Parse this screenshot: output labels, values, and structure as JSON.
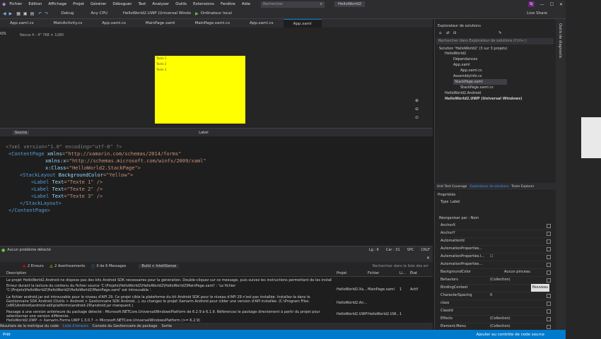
{
  "menu": [
    "Fichier",
    "Edition",
    "Affichage",
    "Projet",
    "Générer",
    "Déboguer",
    "Test",
    "Analyser",
    "Outils",
    "Extensions",
    "Fenêtre",
    "Aide"
  ],
  "search_placeholder": "Rechercher",
  "window_title": "HelloWorld2",
  "user_initials": "SJ",
  "toolbar": {
    "config": "Debug",
    "platform": "Any CPU",
    "startup": "HelloWorld2.UWP (Universal Windo",
    "run": "Ordinateur local",
    "live_share": "Live Share"
  },
  "doc_tabs": [
    "App.xaml.cs",
    "MainActivity.cs",
    "App.xaml.cs",
    "MainPage.xaml",
    "MainPage.xaml.cs",
    "App.xaml.cs",
    "App.xaml"
  ],
  "designer": {
    "label": "Nexus 4 - 4\" 768 × 1280",
    "labels": [
      "Texte 1",
      "Texte 2",
      "Texte 3"
    ],
    "preview_color": "#ffff00"
  },
  "split": {
    "source_label": "Source",
    "label_dropdown": "Label"
  },
  "code": {
    "l1": "<?xml version=\"1.0\" encoding=\"utf-8\" ?>",
    "l2a": "<ContentPage ",
    "l2b": "xmlns",
    "l2c": "=\"http://xamarin.com/schemas/2014/forms\"",
    "l3b": "xmlns:x",
    "l3c": "=\"http://schemas.microsoft.com/winfx/2009/xaml\"",
    "l4b": "x:Class",
    "l4c": "=\"HelloWorld2.StackPage\">",
    "l5a": "<StackLayout ",
    "l5b": "BackgroundColor",
    "l5c": "=\"Yellow\">",
    "l6a": "<Label ",
    "l6b": "Text",
    "l6c": "=\"Texte 1\" />",
    "l7a": "<Label ",
    "l7b": "Text",
    "l7c": "=\"Texte 2\" />",
    "l8a": "<Label ",
    "l8b": "Text",
    "l8c": "=\"Texte 3\" />",
    "l9": "</StackLayout>",
    "l10": "</ContentPage>"
  },
  "editor_status": {
    "issues": "Aucun problème détecté",
    "line": "Lg : 6",
    "col": "Car : 31",
    "spc": "SPC",
    "crlf": "CRLF"
  },
  "error_list": {
    "errors": "2 Erreurs",
    "warnings": "2 Avertissements",
    "messages": "0 de 6 Messages",
    "build": "Build + IntelliSense",
    "search": "Rechercher dans la liste des err",
    "col_desc": "Description",
    "col_project": "Projet",
    "col_file": "Fichier",
    "col_line": "Li...",
    "col_state": "État",
    "rows": [
      {
        "desc": "Le projet HelloWorld2.Android ne dispose pas des kits Android SDK nécessaires pour la génération. Double-cliquez sur ce message, puis suivez les instructions permettant de les installer.",
        "project": "",
        "file": "",
        "line": "",
        "state": ""
      },
      {
        "desc": "Erreur durant la lecture du contenu du fichier source 'C:\\Projets\\HelloWorld2\\HelloWorld2\\HelloWorld2\\MainPage.xaml' : 'Le fichier 'C:\\Projets\\HelloWorld2\\HelloWorld2\\HelloWorld2\\MainPage.xaml' est introuvable.'.",
        "project": "HelloWorld2-Xa...",
        "file": "MainPage.xaml",
        "line": "1",
        "state": "Actif"
      },
      {
        "desc": "La fichier android.jar est introuvable pour le niveau d'API 29. Ce projet cible la plateforme du kit Android SDK pour le niveau d'API 29 n'est pas installée. Installez-la dans le Gestionnaire SDK Android (Outils > Android > Gestionnaire SDK Android...), ou changez le projet Xamarin.Android pour cibler une version d'API installée. (C:\\Program Files (x86)\\Android\\android-sdk\\platforms\\android-29\\android.jar manquant.)",
        "project": "HelloWorld2.An...",
        "file": "",
        "line": "",
        "state": ""
      },
      {
        "desc": "Passage à une version antérieure du package détecté : Microsoft.NETCore.UniversalWindowsPlatform de 6.2.9 à 6.1.9. Référencez le package directement à partir du projet pour sélectionner une version différente.",
        "project": "HelloWorld2.UWP",
        "file": "HelloWorld2.UW...",
        "line": "1",
        "state": ""
      },
      {
        "desc": "HelloWorld2.UWP -> Xamarin.Forms.UWP 1.3.0.7 -> Microsoft.NETCore.UniversalWindowsPlatform (>= 6.2.9)",
        "project": "",
        "file": "",
        "line": "",
        "state": ""
      }
    ]
  },
  "bottom_tabs": [
    "Résultats de la métrique du code",
    "Liste d'erreurs",
    "Console du Gestionnaire de package",
    "Sortie"
  ],
  "status_bar": {
    "left": "Prêt",
    "right": "Ajouter au contrôle de code source"
  },
  "solution_explorer": {
    "title": "Explorateur de solutions",
    "search": "Rechercher dans Explorateur de solutions (Ctrl+;)",
    "items": [
      "Solution 'HelloWorld2' (3 sur 3 projets)",
      "HelloWorld2",
      "Dépendances",
      "App.xaml",
      "App.xaml.cs",
      "AssemblyInfo.cs",
      "StackPage.xaml",
      "StackPage.xaml.cs",
      "HelloWorld2.Android",
      "HelloWorld2.UWP (Universal Windows)"
    ]
  },
  "panel_tabs": [
    "Unit Test Coverage",
    "Explorateur de solutions",
    "Team Explorer"
  ],
  "properties": {
    "title": "Propriétés",
    "type_label": "Type",
    "type_value": "Label",
    "sort": "Réorganiser par : Nom",
    "rows": [
      {
        "name": "AnchorX",
        "value": ""
      },
      {
        "name": "AnchorY",
        "value": ""
      },
      {
        "name": "AutomationId",
        "value": ""
      },
      {
        "name": "AutomationProperties...",
        "value": ""
      },
      {
        "name": "AutomationProperties.I...",
        "value": "☐"
      },
      {
        "name": "AutomationProperties...",
        "value": ""
      },
      {
        "name": "BackgroundColor",
        "value": "Aucun pinceau"
      },
      {
        "name": "Behaviors",
        "value": "(Collection)"
      },
      {
        "name": "BindingContext",
        "value": "Nouveau"
      },
      {
        "name": "CharacterSpacing",
        "value": "0"
      },
      {
        "name": "class",
        "value": ""
      },
      {
        "name": "ClassId",
        "value": ""
      },
      {
        "name": "Effects",
        "value": "(Collection)"
      },
      {
        "name": "Element.Menu",
        "value": "(Collection)"
      }
    ]
  },
  "right_strip_label": "Outils de diagnostic"
}
